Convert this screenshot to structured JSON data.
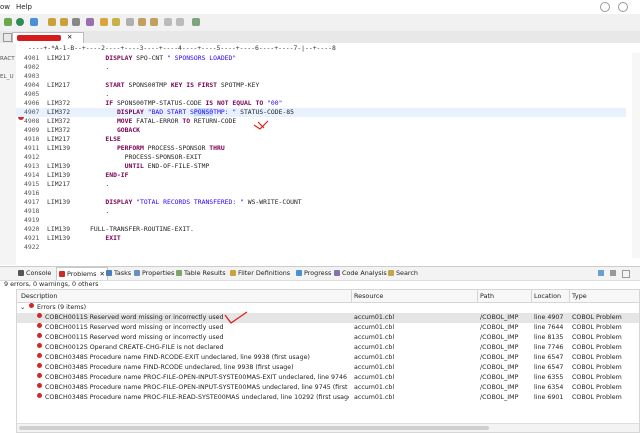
{
  "menu": {
    "items": [
      "ow",
      "Help"
    ]
  },
  "editor": {
    "ruler": "----+-*A-1-B--+----2----+----3----+----4----+----5----+----6----+----7-|--+----8",
    "left_fragments": [
      "RACT",
      "EL_U"
    ],
    "lines": [
      {
        "num": "4901",
        "label": "LIM217",
        "text": "    DISPLAY SPO-CNT \" SPONSORS LOADED\""
      },
      {
        "num": "4902",
        "label": "",
        "text": "    ."
      },
      {
        "num": "4903",
        "label": "",
        "text": ""
      },
      {
        "num": "4904",
        "label": "LIM217",
        "text": "    START SPONS00TMP KEY IS FIRST SPOTMP-KEY"
      },
      {
        "num": "4905",
        "label": "",
        "text": "    ."
      },
      {
        "num": "4906",
        "label": "LIM372",
        "text": "    IF SPONS00TMP-STATUS-CODE IS NOT EQUAL TO \"00\""
      },
      {
        "num": "4907",
        "label": "LIM372",
        "text": "       DISPLAY \"BAD START SPONS0TMP: \" STATUS-CODE-85"
      },
      {
        "num": "4908",
        "label": "LIM372",
        "text": "       MOVE FATAL-ERROR TO RETURN-CODE"
      },
      {
        "num": "4909",
        "label": "LIM372",
        "text": "       GOBACK"
      },
      {
        "num": "4910",
        "label": "LIM217",
        "text": "    ELSE"
      },
      {
        "num": "4911",
        "label": "LIM139",
        "text": "       PERFORM PROCESS-SPONSOR THRU"
      },
      {
        "num": "4912",
        "label": "",
        "text": "         PROCESS-SPONSOR-EXIT"
      },
      {
        "num": "4913",
        "label": "LIM139",
        "text": "         UNTIL END-OF-FILE-STMP"
      },
      {
        "num": "4914",
        "label": "LIM139",
        "text": "    END-IF"
      },
      {
        "num": "4915",
        "label": "LIM217",
        "text": "    ."
      },
      {
        "num": "4916",
        "label": "",
        "text": ""
      },
      {
        "num": "4917",
        "label": "LIM139",
        "text": "    DISPLAY \"TOTAL RECORDS TRANSFERED: \" WS-WRITE-COUNT"
      },
      {
        "num": "4918",
        "label": "",
        "text": "    ."
      },
      {
        "num": "4919",
        "label": "",
        "text": ""
      },
      {
        "num": "4920",
        "label": "LIM139",
        "text": "FULL-TRANSFER-ROUTINE-EXIT."
      },
      {
        "num": "4921",
        "label": "LIM139",
        "text": "    EXIT"
      },
      {
        "num": "4922",
        "label": "",
        "text": ""
      }
    ]
  },
  "views": {
    "tabs": [
      "Console",
      "Problems",
      "Tasks",
      "Properties",
      "Table Results",
      "Filter Definitions",
      "Progress",
      "Code Analysis",
      "Search"
    ]
  },
  "problems": {
    "summary": "9 errors, 0 warnings, 0 others",
    "columns": [
      "Description",
      "Resource",
      "Path",
      "Location",
      "Type"
    ],
    "group_label": "Errors (9 items)",
    "rows": [
      {
        "description": "COBCH0011S Reserved word missing or incorrectly used",
        "resource": "accum01.cbl",
        "path": "/COBOL_IMP",
        "location": "line 4907",
        "type": "COBOL Problem"
      },
      {
        "description": "COBCH0011S Reserved word missing or incorrectly used",
        "resource": "accum01.cbl",
        "path": "/COBOL_IMP",
        "location": "line 7644",
        "type": "COBOL Problem"
      },
      {
        "description": "COBCH0011S Reserved word missing or incorrectly used",
        "resource": "accum01.cbl",
        "path": "/COBOL_IMP",
        "location": "line 8135",
        "type": "COBOL Problem"
      },
      {
        "description": "COBCH0012S Operand CREATE-CHG-FILE is not declared",
        "resource": "accum01.cbl",
        "path": "/COBOL_IMP",
        "location": "line 7746",
        "type": "COBOL Problem"
      },
      {
        "description": "COBCH0348S Procedure name FIND-RCODE-EXIT undeclared, line 9938 (first usage)",
        "resource": "accum01.cbl",
        "path": "/COBOL_IMP",
        "location": "line 6547",
        "type": "COBOL Problem"
      },
      {
        "description": "COBCH0348S Procedure name FIND-RCODE undeclared, line 9938 (first usage)",
        "resource": "accum01.cbl",
        "path": "/COBOL_IMP",
        "location": "line 6547",
        "type": "COBOL Problem"
      },
      {
        "description": "COBCH0348S Procedure name PROC-FILE-OPEN-INPUT-SYSTE00MAS-EXIT undeclared, line 9746 (first usage)",
        "resource": "accum01.cbl",
        "path": "/COBOL_IMP",
        "location": "line 6355",
        "type": "COBOL Problem"
      },
      {
        "description": "COBCH0348S Procedure name PROC-FILE-OPEN-INPUT-SYSTE00MAS undeclared, line 9745 (first usage)",
        "resource": "accum01.cbl",
        "path": "/COBOL_IMP",
        "location": "line 6354",
        "type": "COBOL Problem"
      },
      {
        "description": "COBCH0348S Procedure name PROC-FILE-READ-SYSTE00MAS undeclared, line 10292 (first usage)",
        "resource": "accum01.cbl",
        "path": "/COBOL_IMP",
        "location": "line 6901",
        "type": "COBOL Problem"
      }
    ]
  },
  "colors": {
    "error": "#d12828",
    "annotation": "#e02020",
    "highlight": "#c6dcff"
  }
}
